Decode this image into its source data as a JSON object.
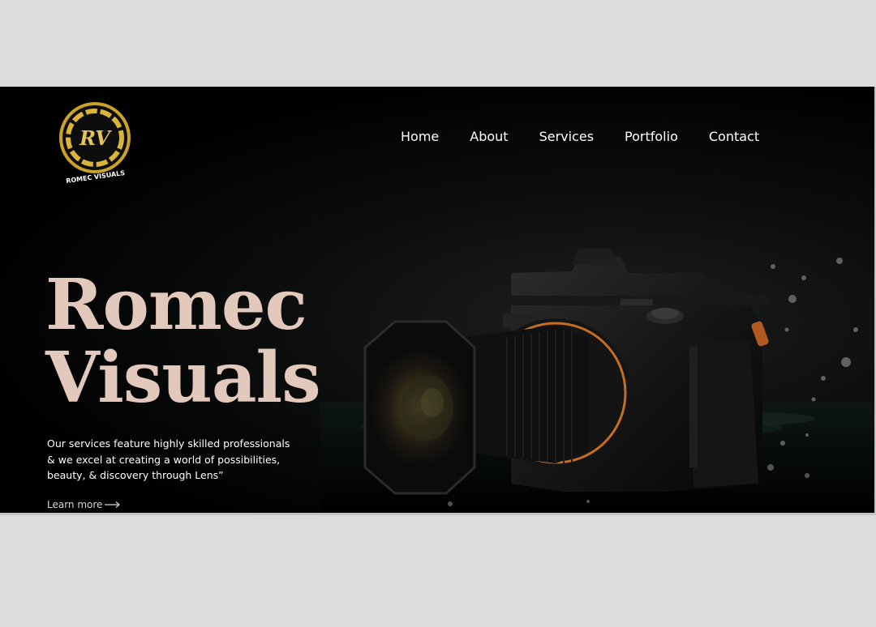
{
  "brand": {
    "monogram": "RV",
    "name": "ROMEC VISUALS",
    "gold": "#c9a227"
  },
  "nav": {
    "home": "Home",
    "about": "About",
    "services": "Services",
    "portfolio": "Portfolio",
    "contact": "Contact"
  },
  "hero": {
    "title_line1": "Romec",
    "title_line2": "Visuals",
    "title_color": "#e2c9bc",
    "desc_line1": "Our services feature highly skilled professionals",
    "desc_line2": "& we excel at creating a world of possibilities,",
    "desc_line3": "beauty, & discovery through Lens”",
    "cta": "Learn more",
    "cta_icon": "long-arrow-right-icon",
    "image": "camera-with-water-droplets"
  }
}
